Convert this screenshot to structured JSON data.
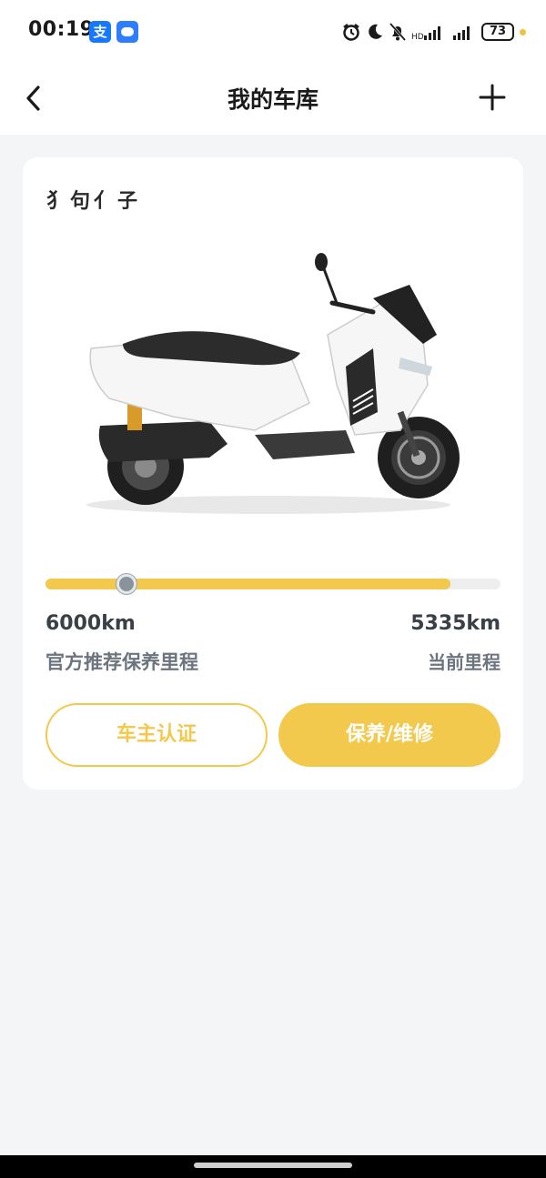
{
  "status_bar": {
    "time": "00:19",
    "alipay_glyph": "支",
    "battery": "73",
    "icons": [
      "alarm-icon",
      "moon-icon",
      "mute-bell-icon",
      "signal-icon",
      "signal-icon",
      "battery-icon"
    ],
    "accent": "#f0c23b"
  },
  "header": {
    "title": "我的车库",
    "back_icon": "chevron-left-icon",
    "add_icon": "plus-icon"
  },
  "vehicle": {
    "name": "犭句亻子",
    "image": "white-scooter"
  },
  "mileage": {
    "progress_fraction": 0.89,
    "marker_fraction": 0.18,
    "recommended_value": "6000km",
    "recommended_label": "官方推荐保养里程",
    "current_value": "5335km",
    "current_label": "当前里程"
  },
  "buttons": {
    "owner_verify": "车主认证",
    "maintenance": "保养/维修"
  },
  "colors": {
    "accent": "#f2c94c",
    "background": "#f4f5f7"
  }
}
